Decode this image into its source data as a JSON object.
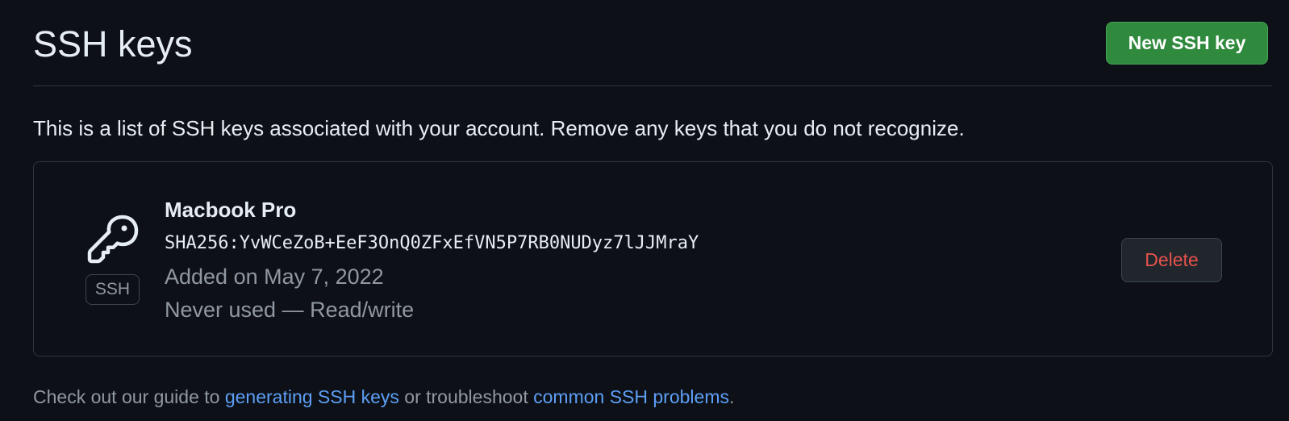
{
  "header": {
    "title": "SSH keys",
    "new_key_label": "New SSH key"
  },
  "intro": "This is a list of SSH keys associated with your account. Remove any keys that you do not recognize.",
  "keys": [
    {
      "title": "Macbook Pro",
      "fingerprint": "SHA256:YvWCeZoB+EeF3OnQ0ZFxEfVN5P7RB0NUDyz7lJJMraY",
      "added": "Added on May 7, 2022",
      "usage": "Never used — Read/write",
      "badge": "SSH",
      "icon": "key-icon",
      "delete_label": "Delete"
    }
  ],
  "footer": {
    "prefix": "Check out our guide to ",
    "link1": "generating SSH keys",
    "middle": " or troubleshoot ",
    "link2": "common SSH problems",
    "suffix": "."
  },
  "colors": {
    "background": "#0d1117",
    "primary_button": "#2f8a3e",
    "danger_text": "#e5534b",
    "link": "#5d9ef5"
  }
}
